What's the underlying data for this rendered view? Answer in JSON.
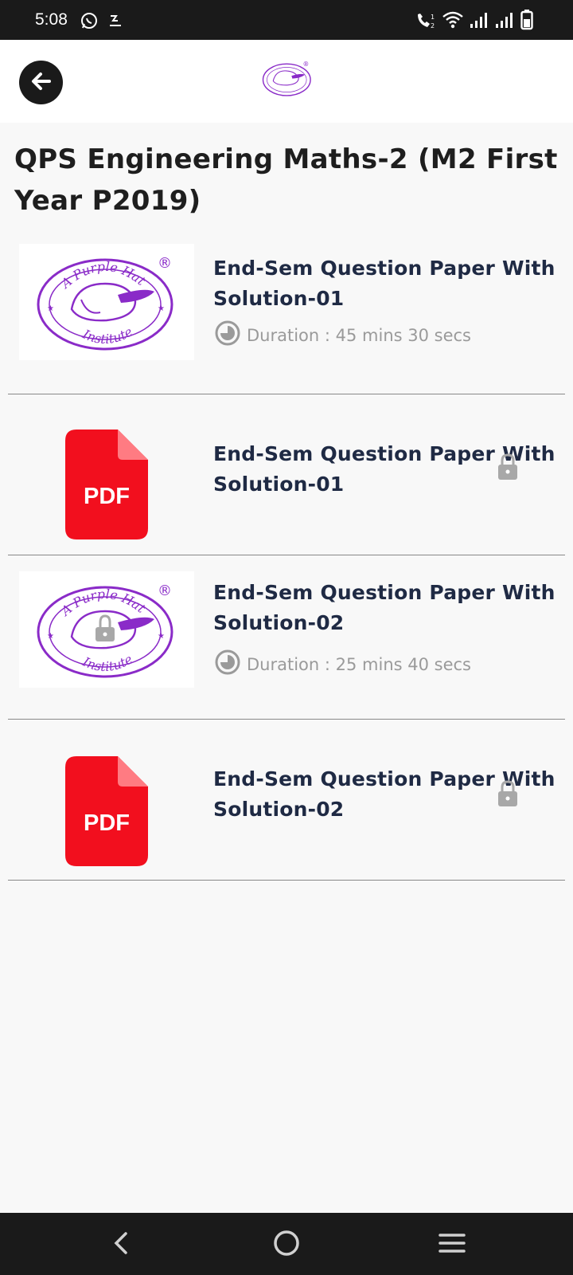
{
  "status_bar": {
    "time": "5:08"
  },
  "header": {
    "back_icon": "arrow-left-icon",
    "logo": "purple-hat-institute-logo"
  },
  "page": {
    "title": "QPS Engineering Maths-2 (M2 First Year P2019)"
  },
  "logo_text": {
    "top": "A Purple Hat",
    "bottom": "Institute",
    "mark": "®"
  },
  "items": [
    {
      "type": "video",
      "title": "End-Sem Question Paper With Solution-01",
      "duration": "Duration : 45 mins 30 secs",
      "locked": false
    },
    {
      "type": "pdf",
      "title": "End-Sem Question Paper With Solution-01",
      "pdf_label": "PDF",
      "locked": true
    },
    {
      "type": "video",
      "title": "End-Sem Question Paper With Solution-02",
      "duration": "Duration : 25 mins 40 secs",
      "locked": true
    },
    {
      "type": "pdf",
      "title": "End-Sem Question Paper With Solution-02",
      "pdf_label": "PDF",
      "locked": true
    }
  ],
  "colors": {
    "brand_purple": "#8a2bc8",
    "pdf_red": "#f20f1e",
    "title_navy": "#1f2a44"
  }
}
